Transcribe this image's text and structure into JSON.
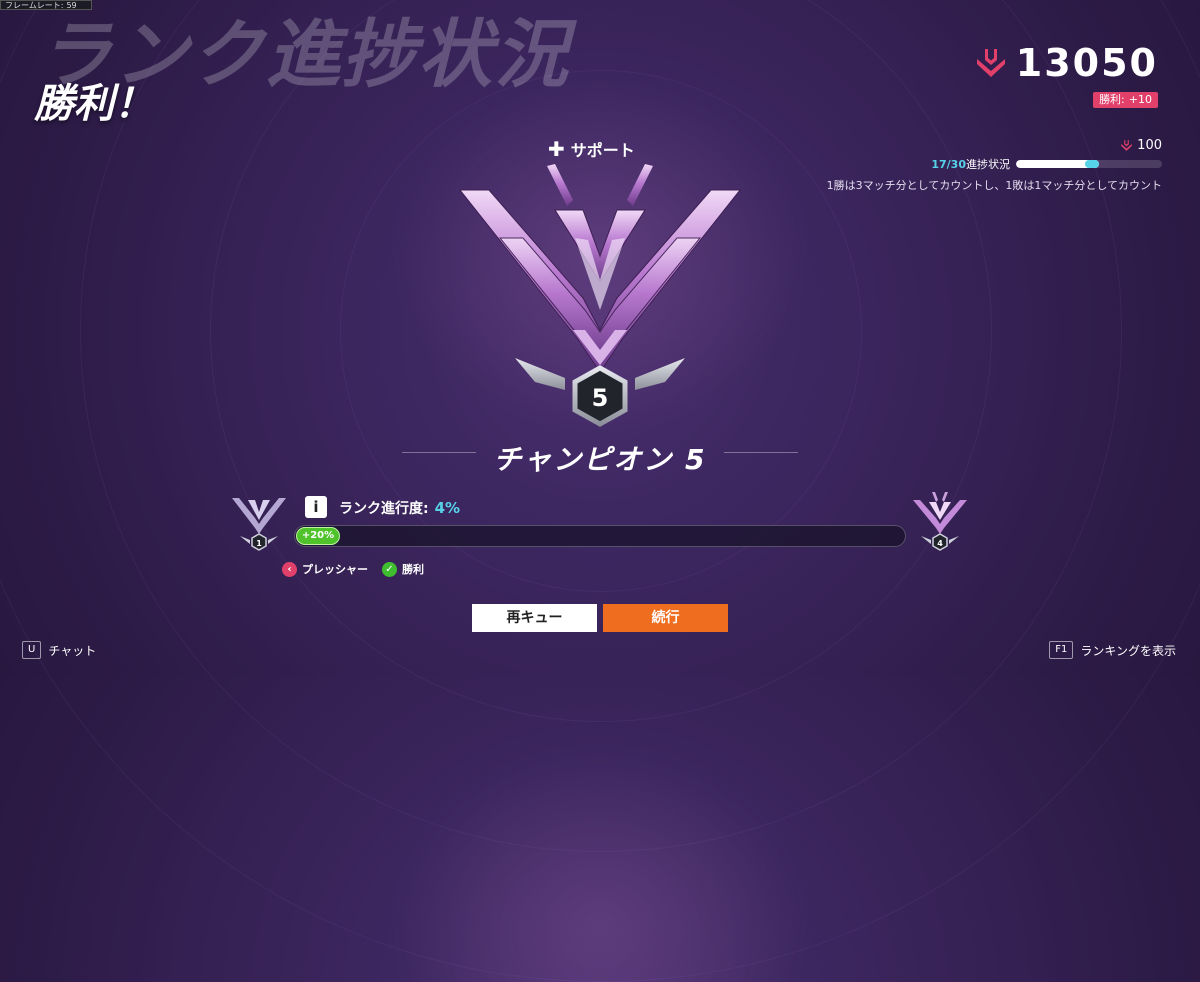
{
  "hud": {
    "frame_rate_label": "フレームレート:",
    "frame_rate_value": "59"
  },
  "header": {
    "title": "ランク進捗状況",
    "result": "勝利！"
  },
  "skill_rating": {
    "value": "13050",
    "badge_label": "勝利:",
    "badge_delta": "+10",
    "icon": "rank-chevron-icon",
    "accent": "#e0406a"
  },
  "progress_tracker": {
    "target": "100",
    "count": "17/30",
    "label": "進捗状況",
    "fraction": 0.567,
    "note": "1勝は3マッチ分としてカウントし、1敗は1マッチ分としてカウント"
  },
  "role": {
    "icon": "plus-icon",
    "label": "サポート"
  },
  "rank": {
    "tier_number": "5",
    "name": "チャンピオン 5"
  },
  "rank_progress": {
    "label": "ランク進行度:",
    "percent_label": "4%",
    "fill": 0.04,
    "gain_label": "+20%",
    "prev_division": "1",
    "next_division": "4"
  },
  "modifiers": [
    {
      "icon": "chevron-left-icon",
      "label": "プレッシャー",
      "color": "#e0406a"
    },
    {
      "icon": "check-icon",
      "label": "勝利",
      "color": "#3fbf2f"
    }
  ],
  "buttons": {
    "requeue": "再キュー",
    "continue": "続行"
  },
  "hints": {
    "chat_key": "U",
    "chat_label": "チャット",
    "ranking_key": "F1",
    "ranking_label": "ランキングを表示"
  },
  "colors": {
    "accent_cyan": "#56d3e8",
    "continue_orange": "#ee6d1e",
    "pink": "#e0406a",
    "green": "#3fbf2f"
  }
}
